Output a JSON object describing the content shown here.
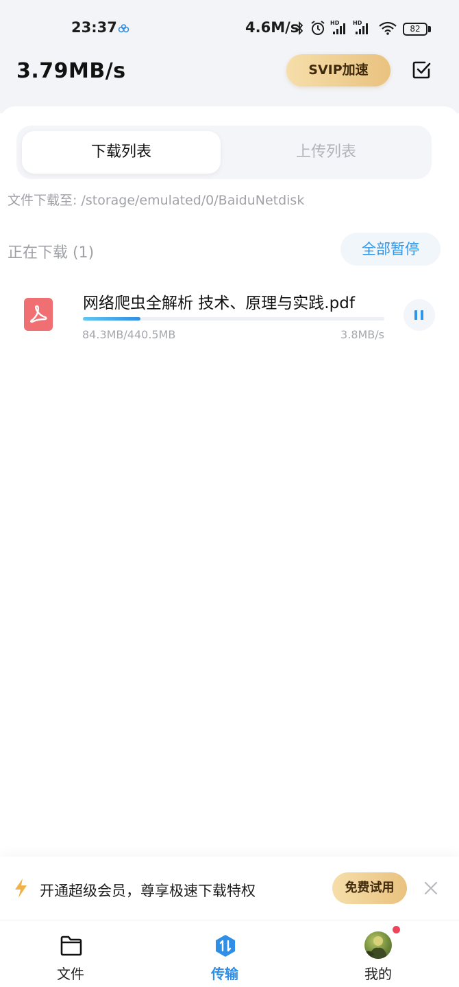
{
  "status_bar": {
    "time": "23:37",
    "network_speed": "4.6M/s",
    "battery": "82"
  },
  "header": {
    "total_speed": "3.79MB/s",
    "svip_button": "SVIP加速"
  },
  "tabs": {
    "download": "下载列表",
    "upload": "上传列表"
  },
  "download_path": "文件下载至: /storage/emulated/0/BaiduNetdisk",
  "section": {
    "title": "正在下载 (1)",
    "pause_all": "全部暂停"
  },
  "downloads": [
    {
      "name": "网络爬虫全解析 技术、原理与实践.pdf",
      "progress_text": "84.3MB/440.5MB",
      "progress_fraction": 0.19,
      "speed": "3.8MB/s"
    }
  ],
  "promo": {
    "text": "开通超级会员，尊享极速下载特权",
    "trial_button": "免费试用"
  },
  "nav": {
    "files": "文件",
    "transfer": "传输",
    "me": "我的"
  },
  "colors": {
    "accent_blue": "#2f8fe6",
    "gold": "#e9c27f",
    "pdf_red": "#ef6f72"
  }
}
